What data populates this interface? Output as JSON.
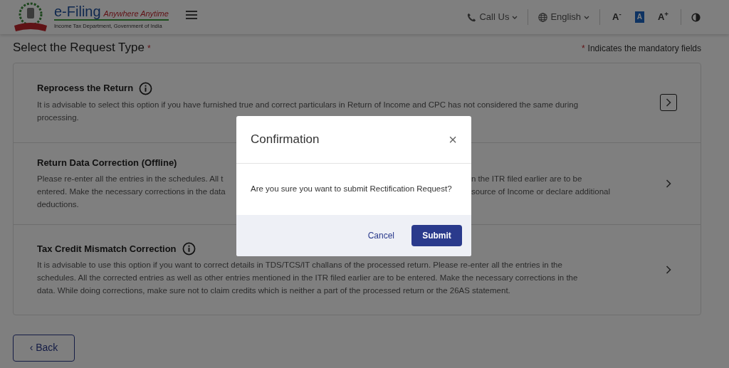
{
  "header": {
    "brand": "e-Filing",
    "tagline": "Anywhere Anytime",
    "subtitle": "Income Tax Department, Government of India",
    "menus": [
      {
        "label": "Call Us",
        "kind": "phone"
      },
      {
        "label": "English",
        "kind": "globe"
      }
    ],
    "font_controls": [
      {
        "label": "A",
        "sign": "-",
        "selected": false
      },
      {
        "label": "A",
        "selected": true
      },
      {
        "label": "A",
        "sign": "+",
        "selected": false
      }
    ]
  },
  "page": {
    "title": "Select the Request Type",
    "required_mark": "*",
    "mandatory_note_mark": "*",
    "mandatory_note": "Indicates the mandatory fields"
  },
  "options": [
    {
      "title": "Reprocess the Return",
      "info": true,
      "focused": true,
      "lines": [
        {
          "left": "It is advisable to select this option if you have furnished true and correct particulars in Return of Income and CPC has not considered the same during"
        },
        {
          "left": "processing."
        }
      ]
    },
    {
      "title": "Return Data Correction (Offline)",
      "info": false,
      "focused": false,
      "lines": [
        {
          "left": "Please re-enter all the entries in the schedules. All t",
          "right": "n the ITR filed earlier are to be"
        },
        {
          "left": "entered. Make the necessary corrections in the data",
          "right": "source of Income or declare additional"
        },
        {
          "left": "deductions."
        }
      ]
    },
    {
      "title": "Tax Credit Mismatch Correction",
      "info": true,
      "focused": false,
      "lines": [
        {
          "left": "It is advisable to use this option if you want to correct details in TDS/TCS/IT challans of the processed return. Please re-enter all the entries in the"
        },
        {
          "left": "schedules. All the corrected entries as well as other entries mentioned in the ITR filed earlier are to be entered. Make the necessary corrections in the"
        },
        {
          "left": "data. While doing corrections, make sure not to claim credits which is neither a part of the processed return or the 26AS statement."
        }
      ]
    }
  ],
  "back_button": {
    "label": "Back",
    "icon": "‹"
  },
  "modal": {
    "title": "Confirmation",
    "close": "×",
    "message": "Are you sure you want to submit Rectification Request?",
    "cancel": "Cancel",
    "submit": "Submit"
  }
}
